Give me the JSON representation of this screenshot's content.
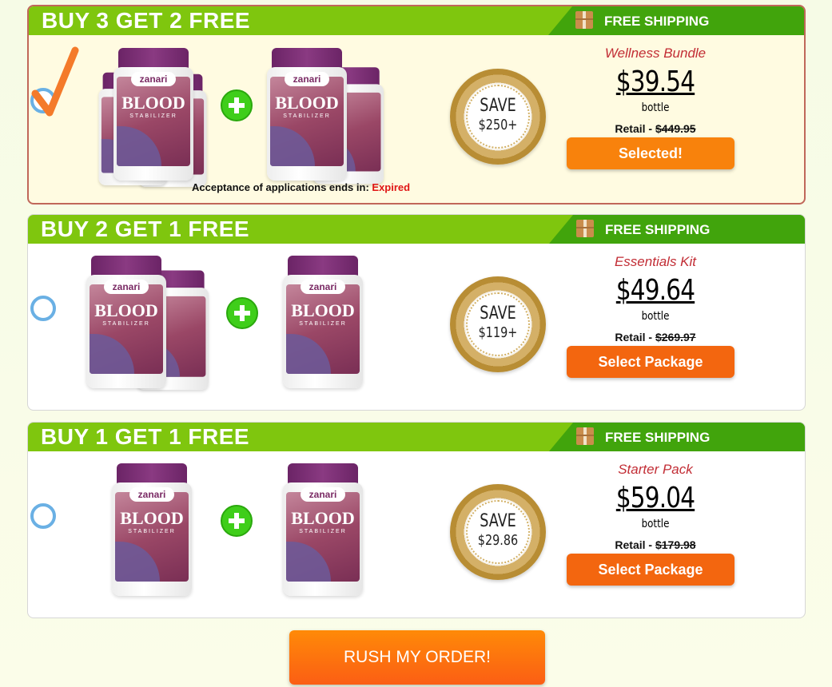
{
  "packages": [
    {
      "headline": "BUY 3 GET 2 FREE",
      "shipping": "FREE SHIPPING",
      "name": "Wellness Bundle",
      "price": "$39.54",
      "unit": "bottle",
      "retail_label": "Retail -",
      "retail_old": "$449.95",
      "save_label": "SAVE",
      "save_amount": "$250+",
      "button": "Selected!",
      "selected": true,
      "bottle_brand": "zanari",
      "bottle_title": "BLOOD",
      "bottle_sub": "STABILIZER",
      "acceptance_label": "Acceptance of applications ends in:",
      "acceptance_status": "Expired"
    },
    {
      "headline": "BUY 2 GET 1 FREE",
      "shipping": "FREE SHIPPING",
      "name": "Essentials Kit",
      "price": "$49.64",
      "unit": "bottle",
      "retail_label": "Retail -",
      "retail_old": "$269.97",
      "save_label": "SAVE",
      "save_amount": "$119+",
      "button": "Select Package",
      "selected": false,
      "bottle_brand": "zanari",
      "bottle_title": "BLOOD",
      "bottle_sub": "STABILIZER"
    },
    {
      "headline": "BUY 1 GET 1 FREE",
      "shipping": "FREE SHIPPING",
      "name": "Starter Pack",
      "price": "$59.04",
      "unit": "bottle",
      "retail_label": "Retail -",
      "retail_old": "$179.98",
      "save_label": "SAVE",
      "save_amount": "$29.86",
      "button": "Select Package",
      "selected": false,
      "bottle_brand": "zanari",
      "bottle_title": "BLOOD",
      "bottle_sub": "STABILIZER"
    }
  ],
  "cta": "RUSH MY ORDER!",
  "colors": {
    "header_green": "#7fc60e",
    "shipping_green": "#41a40c",
    "button_orange": "#f3660f",
    "radio_blue": "#6ab0e4",
    "price_name_red": "#c22d35"
  }
}
